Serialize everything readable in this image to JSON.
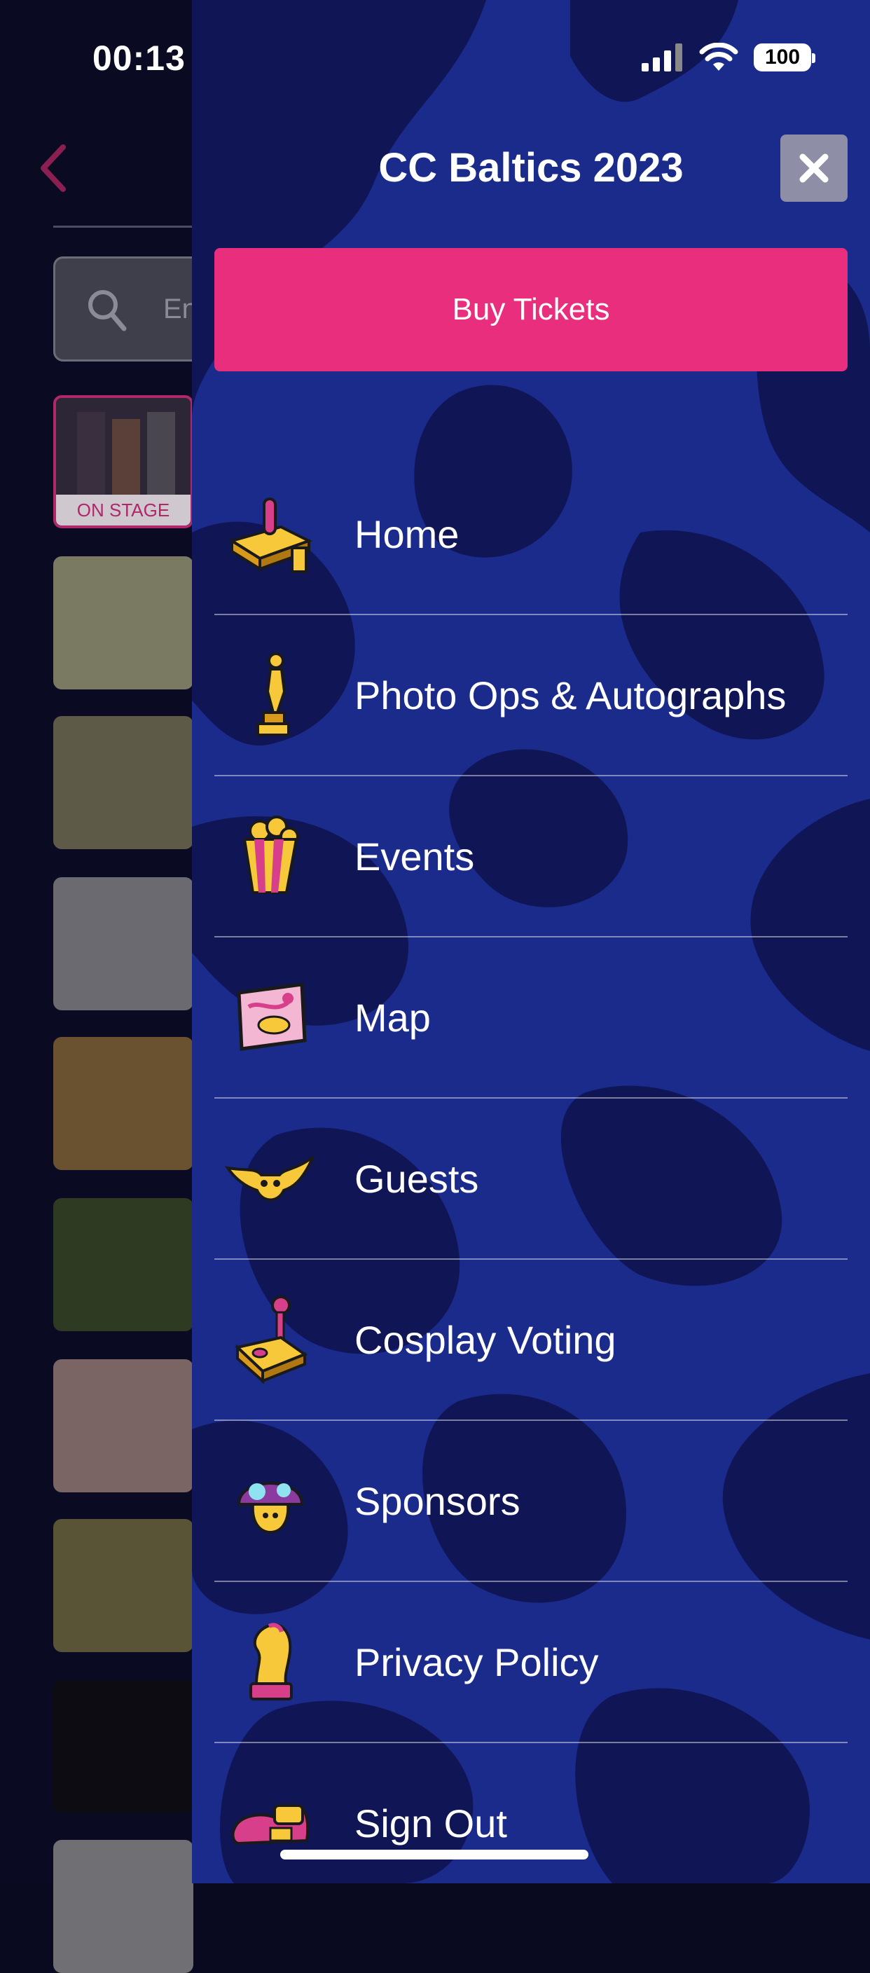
{
  "status_bar": {
    "time": "00:13",
    "battery": "100"
  },
  "background": {
    "search_placeholder": "En",
    "on_stage_label": "ON STAGE"
  },
  "drawer": {
    "title": "CC Baltics 2023",
    "close_icon": "close-icon",
    "buy_tickets_label": "Buy Tickets",
    "menu": [
      {
        "label": "Home",
        "icon": "joystick-base-icon"
      },
      {
        "label": "Photo Ops & Autographs",
        "icon": "trophy-icon"
      },
      {
        "label": "Events",
        "icon": "popcorn-icon"
      },
      {
        "label": "Map",
        "icon": "map-icon"
      },
      {
        "label": "Guests",
        "icon": "alien-icon"
      },
      {
        "label": "Cosplay Voting",
        "icon": "joystick-icon"
      },
      {
        "label": "Sponsors",
        "icon": "mushroom-icon"
      },
      {
        "label": "Privacy Policy",
        "icon": "chess-knight-icon"
      },
      {
        "label": "Sign Out",
        "icon": "shoe-icon"
      }
    ]
  },
  "colors": {
    "accent": "#e92e7e",
    "drawer_bg": "#1a2b8c",
    "drawer_pattern": "#0f1555",
    "close_bg": "#8e8ea6"
  }
}
